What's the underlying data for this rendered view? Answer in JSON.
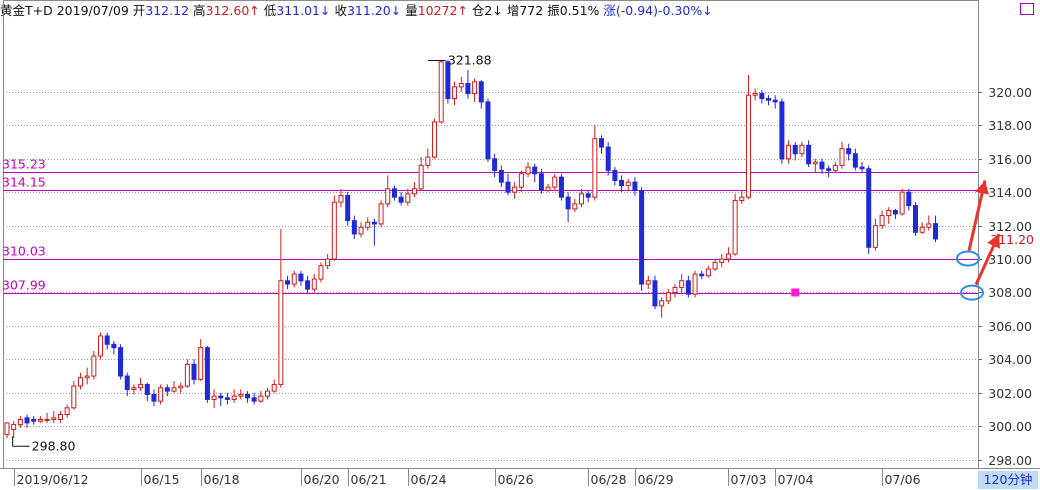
{
  "header": {
    "name": "黄金T+D",
    "date": "2019/07/09",
    "open_label": "开",
    "open_value": "312.12",
    "high_label": "高",
    "high_value": "312.60↑",
    "low_label": "低",
    "low_value": "311.01↓",
    "close_label": "收",
    "close_value": "311.20↓",
    "volume_label": "量",
    "volume_value": "10272↑",
    "position_label": "仓2↓",
    "increase_label": "增772",
    "amplitude_label": "振0.51%",
    "change_label": "涨(-0.94)-0.30%↓"
  },
  "period_label": "120分钟",
  "colors": {
    "up": "#d01c1c",
    "down": "#1f2ad6",
    "level_line": "#c000c0",
    "grid": "#9a9a9a",
    "arrow": "#e8342a",
    "circle": "#2f8fde"
  },
  "chart_data": {
    "type": "candlestick",
    "ylim": [
      297.5,
      324.0
    ],
    "y_ticks": [
      298,
      300,
      302,
      304,
      306,
      308,
      310,
      312,
      314,
      316,
      318,
      320
    ],
    "y_tick_labels": [
      "298.00",
      "300.00",
      "302.00",
      "304.00",
      "306.00",
      "308.00",
      "310.00",
      "312.00",
      "314.00",
      "316.00",
      "318.00",
      "320.00"
    ],
    "x_labels": [
      {
        "text": "2019/06/12",
        "bar": 1
      },
      {
        "text": "06/15",
        "bar": 20
      },
      {
        "text": "06/18",
        "bar": 29
      },
      {
        "text": "06/20",
        "bar": 44
      },
      {
        "text": "06/21",
        "bar": 51
      },
      {
        "text": "06/24",
        "bar": 60
      },
      {
        "text": "06/26",
        "bar": 73
      },
      {
        "text": "06/28",
        "bar": 87
      },
      {
        "text": "06/29",
        "bar": 94
      },
      {
        "text": "07/03",
        "bar": 108
      },
      {
        "text": "07/04",
        "bar": 115
      },
      {
        "text": "07/06",
        "bar": 131
      }
    ],
    "levels": [
      {
        "value": 315.23,
        "label": "315.23"
      },
      {
        "value": 314.15,
        "label": "314.15"
      },
      {
        "value": 310.03,
        "label": "310.03"
      },
      {
        "value": 307.99,
        "label": "307.99"
      }
    ],
    "max_annotation": {
      "value": 321.88,
      "label": "321.88",
      "bar": 63
    },
    "min_annotation": {
      "value": 298.8,
      "label": "298.80",
      "bar": 1
    },
    "last_price_label": "311.20",
    "marker": {
      "bar": 118,
      "value": 308.0
    },
    "candles": [
      [
        299.5,
        300.2,
        300.0,
        299.3
      ],
      [
        299.8,
        300.1,
        300.3,
        299.3
      ],
      [
        300.1,
        300.4,
        300.6,
        299.9
      ],
      [
        300.5,
        300.2,
        300.7,
        299.9
      ],
      [
        300.4,
        300.3,
        300.6,
        300.1
      ],
      [
        300.3,
        300.4,
        300.6,
        300.2
      ],
      [
        300.4,
        300.4,
        300.8,
        300.2
      ],
      [
        300.4,
        300.5,
        300.9,
        300.2
      ],
      [
        300.4,
        300.7,
        300.9,
        300.2
      ],
      [
        300.7,
        301.1,
        301.3,
        300.5
      ],
      [
        301.1,
        302.4,
        302.7,
        301.0
      ],
      [
        302.4,
        302.9,
        303.2,
        302.2
      ],
      [
        302.9,
        303.0,
        303.5,
        302.5
      ],
      [
        303.0,
        304.2,
        304.5,
        302.8
      ],
      [
        304.2,
        305.4,
        305.6,
        304.0
      ],
      [
        305.4,
        304.9,
        305.6,
        304.6
      ],
      [
        304.9,
        304.7,
        305.1,
        304.3
      ],
      [
        304.7,
        303.0,
        304.9,
        302.8
      ],
      [
        303.0,
        302.2,
        303.2,
        301.8
      ],
      [
        302.2,
        302.3,
        302.5,
        301.9
      ],
      [
        302.3,
        302.5,
        302.9,
        302.1
      ],
      [
        302.5,
        301.9,
        302.6,
        301.5
      ],
      [
        301.9,
        301.5,
        302.2,
        301.2
      ],
      [
        301.5,
        302.3,
        302.5,
        301.3
      ],
      [
        302.3,
        302.1,
        302.5,
        301.8
      ],
      [
        302.1,
        302.3,
        302.7,
        302.0
      ],
      [
        302.3,
        302.4,
        302.6,
        302.0
      ],
      [
        302.4,
        303.7,
        304.0,
        302.3
      ],
      [
        303.7,
        302.8,
        304.0,
        302.5
      ],
      [
        302.8,
        304.7,
        305.2,
        302.7
      ],
      [
        304.7,
        301.6,
        304.8,
        301.4
      ],
      [
        301.6,
        301.8,
        302.2,
        301.1
      ],
      [
        301.8,
        301.7,
        302.0,
        301.2
      ],
      [
        301.7,
        301.6,
        302.0,
        301.3
      ],
      [
        301.6,
        301.8,
        302.2,
        301.4
      ],
      [
        301.8,
        301.9,
        302.2,
        301.6
      ],
      [
        301.9,
        301.7,
        302.1,
        301.4
      ],
      [
        301.7,
        301.5,
        302.0,
        301.3
      ],
      [
        301.5,
        301.8,
        302.1,
        301.4
      ],
      [
        301.8,
        302.1,
        302.3,
        301.6
      ],
      [
        302.1,
        302.5,
        302.8,
        302.0
      ],
      [
        302.5,
        308.7,
        311.8,
        302.3
      ],
      [
        308.7,
        308.5,
        309.0,
        308.2
      ],
      [
        308.5,
        309.1,
        309.3,
        308.3
      ],
      [
        309.1,
        308.7,
        309.3,
        308.4
      ],
      [
        308.7,
        308.2,
        309.0,
        307.9
      ],
      [
        308.2,
        308.8,
        309.1,
        308.0
      ],
      [
        308.8,
        309.6,
        309.8,
        308.6
      ],
      [
        309.6,
        310.0,
        310.3,
        309.4
      ],
      [
        310.0,
        313.4,
        313.8,
        309.9
      ],
      [
        313.4,
        313.8,
        314.2,
        313.1
      ],
      [
        313.8,
        312.3,
        314.0,
        312.0
      ],
      [
        312.3,
        311.5,
        312.6,
        311.2
      ],
      [
        311.5,
        311.9,
        312.2,
        311.3
      ],
      [
        311.9,
        312.2,
        312.5,
        311.7
      ],
      [
        312.2,
        312.1,
        312.4,
        310.8
      ],
      [
        312.1,
        313.3,
        313.5,
        311.9
      ],
      [
        313.3,
        314.2,
        315.0,
        313.1
      ],
      [
        314.2,
        313.7,
        314.4,
        313.5
      ],
      [
        313.7,
        313.4,
        314.0,
        313.2
      ],
      [
        313.4,
        313.9,
        314.2,
        313.2
      ],
      [
        313.9,
        314.2,
        314.6,
        313.7
      ],
      [
        314.2,
        315.6,
        316.1,
        314.1
      ],
      [
        315.6,
        316.1,
        316.6,
        315.4
      ],
      [
        316.1,
        318.2,
        318.4,
        316.0
      ],
      [
        318.2,
        321.8,
        321.9,
        318.1
      ],
      [
        321.8,
        319.6,
        321.9,
        319.3
      ],
      [
        319.6,
        320.3,
        320.6,
        319.2
      ],
      [
        320.3,
        320.5,
        320.9,
        320.0
      ],
      [
        320.5,
        319.9,
        321.3,
        319.6
      ],
      [
        319.9,
        320.6,
        320.8,
        319.4
      ],
      [
        320.6,
        319.4,
        320.7,
        319.0
      ],
      [
        319.4,
        316.0,
        319.6,
        315.8
      ],
      [
        316.0,
        315.3,
        316.3,
        314.9
      ],
      [
        315.3,
        314.6,
        315.6,
        314.3
      ],
      [
        314.6,
        314.0,
        315.1,
        313.8
      ],
      [
        314.0,
        314.3,
        314.6,
        313.6
      ],
      [
        314.3,
        315.1,
        315.3,
        314.0
      ],
      [
        315.1,
        315.5,
        315.8,
        314.9
      ],
      [
        315.5,
        315.1,
        315.7,
        314.6
      ],
      [
        315.1,
        314.1,
        315.4,
        313.9
      ],
      [
        314.1,
        314.3,
        314.5,
        314.0
      ],
      [
        314.3,
        314.9,
        315.1,
        314.1
      ],
      [
        314.9,
        313.7,
        315.1,
        313.5
      ],
      [
        313.7,
        313.0,
        314.0,
        312.2
      ],
      [
        313.0,
        313.3,
        313.6,
        312.8
      ],
      [
        313.3,
        313.9,
        314.2,
        313.1
      ],
      [
        313.9,
        313.7,
        314.1,
        313.4
      ],
      [
        313.7,
        317.2,
        318.0,
        313.5
      ],
      [
        317.2,
        316.7,
        317.4,
        316.3
      ],
      [
        316.7,
        315.3,
        317.0,
        315.0
      ],
      [
        315.3,
        314.7,
        315.5,
        314.4
      ],
      [
        314.7,
        314.4,
        315.0,
        314.0
      ],
      [
        314.4,
        314.6,
        314.8,
        314.1
      ],
      [
        314.6,
        314.1,
        314.9,
        313.8
      ],
      [
        314.1,
        308.5,
        314.3,
        308.1
      ],
      [
        308.5,
        308.7,
        309.0,
        308.2
      ],
      [
        308.7,
        307.2,
        309.0,
        307.0
      ],
      [
        307.2,
        307.5,
        307.7,
        306.5
      ],
      [
        307.5,
        308.0,
        308.2,
        307.3
      ],
      [
        308.0,
        308.3,
        308.5,
        307.7
      ],
      [
        308.3,
        308.7,
        309.1,
        308.0
      ],
      [
        308.7,
        307.9,
        309.0,
        307.7
      ],
      [
        307.9,
        309.1,
        309.3,
        307.7
      ],
      [
        309.1,
        309.0,
        309.3,
        308.8
      ],
      [
        309.0,
        309.4,
        309.6,
        308.9
      ],
      [
        309.4,
        309.8,
        310.0,
        309.3
      ],
      [
        309.8,
        310.0,
        310.3,
        309.5
      ],
      [
        310.0,
        310.3,
        310.7,
        309.8
      ],
      [
        310.3,
        313.5,
        313.9,
        310.2
      ],
      [
        313.5,
        313.7,
        314.1,
        313.3
      ],
      [
        313.7,
        319.8,
        321.0,
        313.6
      ],
      [
        319.8,
        319.9,
        320.2,
        319.5
      ],
      [
        319.9,
        319.6,
        320.1,
        319.3
      ],
      [
        319.6,
        319.5,
        319.8,
        319.2
      ],
      [
        319.5,
        319.4,
        319.8,
        319.0
      ],
      [
        319.4,
        316.0,
        319.6,
        315.7
      ],
      [
        316.0,
        316.8,
        317.1,
        315.7
      ],
      [
        316.8,
        316.3,
        317.0,
        315.9
      ],
      [
        316.3,
        316.8,
        317.0,
        316.1
      ],
      [
        316.8,
        315.7,
        317.1,
        315.5
      ],
      [
        315.7,
        315.8,
        316.0,
        315.2
      ],
      [
        315.8,
        315.4,
        316.0,
        315.1
      ],
      [
        315.4,
        315.3,
        315.6,
        314.9
      ],
      [
        315.3,
        315.6,
        315.8,
        315.2
      ],
      [
        315.6,
        316.6,
        317.0,
        315.4
      ],
      [
        316.6,
        316.3,
        316.9,
        315.9
      ],
      [
        316.3,
        315.5,
        316.6,
        315.3
      ],
      [
        315.5,
        315.4,
        315.8,
        315.2
      ],
      [
        315.4,
        310.7,
        315.6,
        310.3
      ],
      [
        310.7,
        312.0,
        312.4,
        310.5
      ],
      [
        312.0,
        312.6,
        312.9,
        311.8
      ],
      [
        312.6,
        312.9,
        313.1,
        312.1
      ],
      [
        312.9,
        312.7,
        313.0,
        312.4
      ],
      [
        312.7,
        314.0,
        314.2,
        312.6
      ],
      [
        314.0,
        313.2,
        314.2,
        312.9
      ],
      [
        313.2,
        311.6,
        313.4,
        311.4
      ],
      [
        311.6,
        311.9,
        312.2,
        311.5
      ],
      [
        311.9,
        312.1,
        312.6,
        311.7
      ],
      [
        312.12,
        311.2,
        312.6,
        311.01
      ]
    ]
  }
}
